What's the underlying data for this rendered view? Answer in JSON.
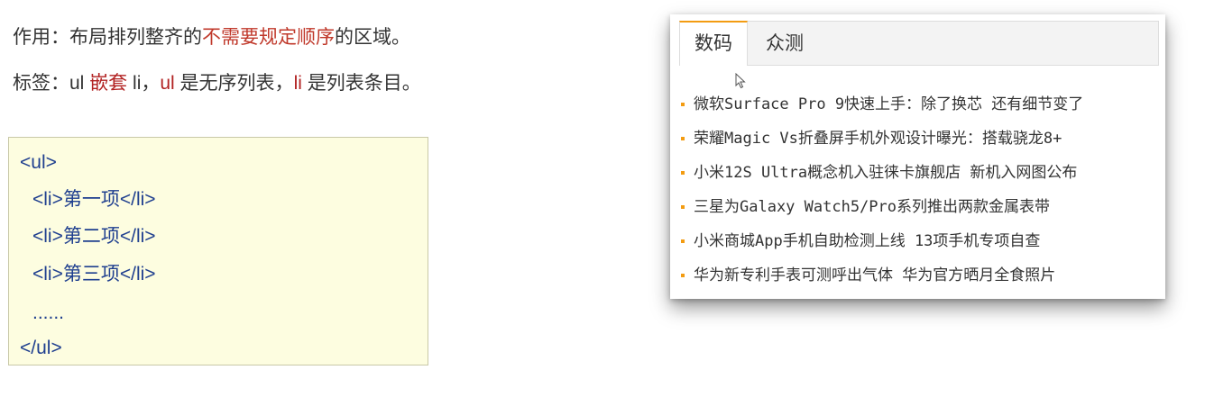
{
  "intro": {
    "line1": {
      "prefix": "作用：布局排列整齐的",
      "highlight": "不需要规定顺序",
      "suffix": "的区域。"
    },
    "line2": {
      "prefix": "标签：ul ",
      "nest": "嵌套",
      "mid": " li，",
      "ul": "ul",
      "mid2": " 是无序列表，",
      "li": "li",
      "suffix": " 是列表条目。"
    }
  },
  "code": {
    "lines": [
      "<ul>",
      "<li>第一项</li>",
      "<li>第二项</li>",
      "<li>第三项</li>",
      "......",
      "</ul>"
    ]
  },
  "widget": {
    "tabs": [
      "数码",
      "众测"
    ],
    "accent": "#f39c12",
    "news": [
      "微软Surface Pro 9快速上手：除了换芯 还有细节变了",
      "荣耀Magic Vs折叠屏手机外观设计曝光：搭载骁龙8+",
      "小米12S Ultra概念机入驻徕卡旗舰店 新机入网图公布",
      "三星为Galaxy Watch5/Pro系列推出两款金属表带",
      "小米商城App手机自助检测上线 13项手机专项自查",
      "华为新专利手表可测呼出气体 华为官方晒月全食照片"
    ]
  },
  "colors": {
    "highlight_red": "#c0392b",
    "code_text": "#1f3f8f",
    "code_bg": "#fdfde0"
  }
}
